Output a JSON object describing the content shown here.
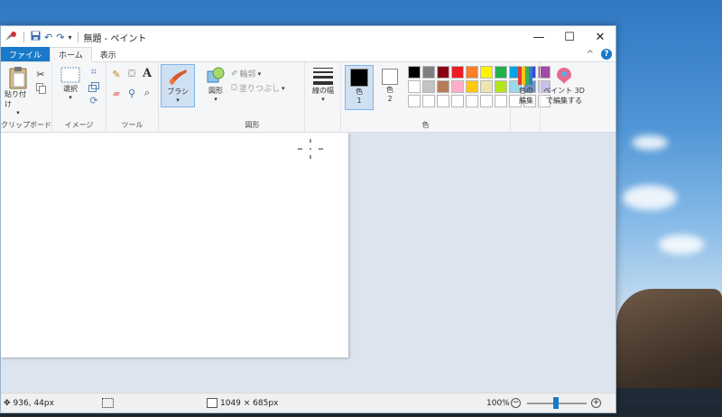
{
  "window": {
    "title": "無題 - ペイント"
  },
  "qat": {
    "customize": "▾"
  },
  "controls": {
    "minimize": "—",
    "maximize": "☐",
    "close": "✕"
  },
  "tabs": {
    "file": "ファイル",
    "home": "ホーム",
    "view": "表示"
  },
  "ribbon_extra": {
    "collapse": "^",
    "help": "?"
  },
  "groups": {
    "clipboard": {
      "label": "クリップボード",
      "paste": "貼り付け"
    },
    "image": {
      "label": "イメージ",
      "select": "選択"
    },
    "tools": {
      "label": "ツール"
    },
    "brush": {
      "label": "ブラシ"
    },
    "shapes": {
      "label": "図形",
      "shapes_btn": "図形",
      "outline": "輪郭",
      "fill": "塗りつぶし"
    },
    "size": {
      "label": "線の幅"
    },
    "colors": {
      "label": "色",
      "color1": "色",
      "color1_num": "1",
      "color2": "色",
      "color2_num": "2",
      "edit": "色の",
      "edit2": "編集"
    },
    "paint3d": {
      "line1": "ペイント 3D",
      "line2": "で編集する"
    }
  },
  "palette": {
    "row1": [
      "#000000",
      "#7f7f7f",
      "#880015",
      "#ed1c24",
      "#ff7f27",
      "#fff200",
      "#22b14c",
      "#00a2e8",
      "#3f48cc",
      "#a349a4"
    ],
    "row2": [
      "#ffffff",
      "#c3c3c3",
      "#b97a57",
      "#ffaec9",
      "#ffc90e",
      "#efe4b0",
      "#b5e61d",
      "#99d9ea",
      "#7092be",
      "#c8bfe7"
    ],
    "color1": "#000000",
    "color2": "#ffffff"
  },
  "status": {
    "cursor_pos": "936, 44px",
    "canvas_size": "1049 × 685px",
    "zoom": "100%",
    "zoom_out": "−",
    "zoom_in": "+"
  }
}
